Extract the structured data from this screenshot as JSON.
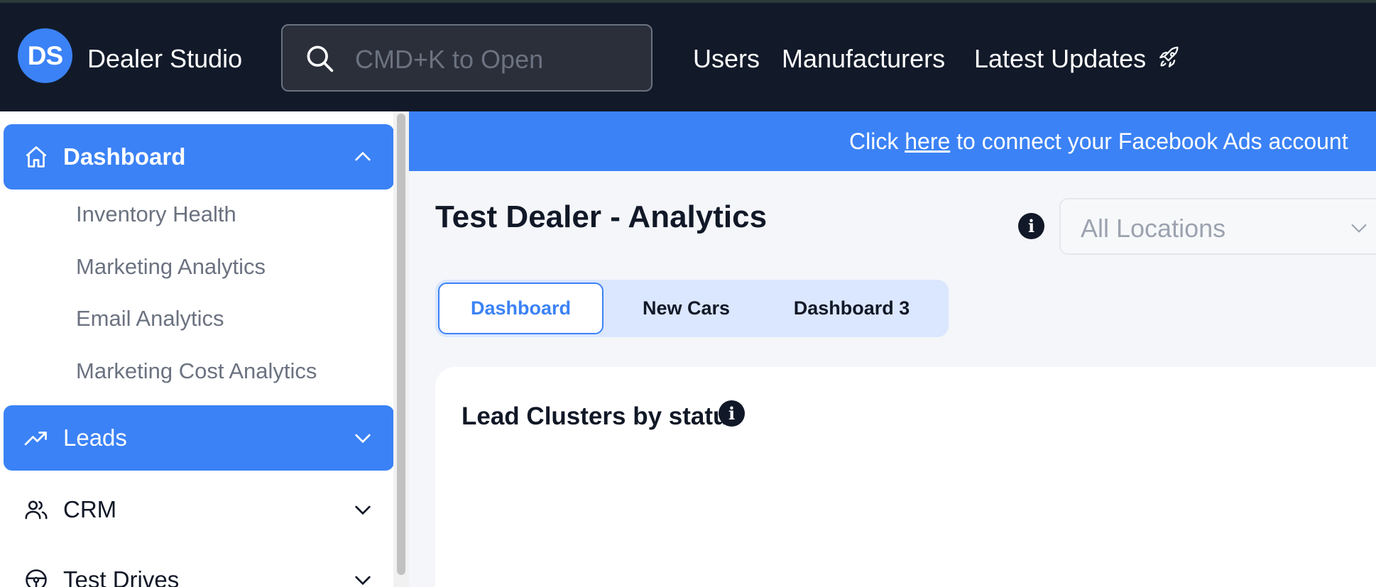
{
  "header": {
    "logo_text": "DS",
    "app_name": "Dealer Studio",
    "search_placeholder": "CMD+K to Open",
    "nav": [
      {
        "label": "Users"
      },
      {
        "label": "Manufacturers"
      },
      {
        "label": "Latest Updates",
        "icon": "rocket-icon"
      }
    ]
  },
  "sidebar": {
    "groups": [
      {
        "label": "Dashboard",
        "icon": "home-icon",
        "expanded": true,
        "active": true,
        "items": [
          "Inventory Health",
          "Marketing Analytics",
          "Email Analytics",
          "Marketing Cost Analytics"
        ]
      },
      {
        "label": "Leads",
        "icon": "trending-up-icon",
        "expanded": false,
        "active": true
      },
      {
        "label": "CRM",
        "icon": "users-icon",
        "expanded": false,
        "active": false
      },
      {
        "label": "Test Drives",
        "icon": "steering-wheel-icon",
        "expanded": false,
        "active": false
      }
    ]
  },
  "banner": {
    "prefix": "Click",
    "link": "here",
    "suffix": "to connect your Facebook Ads account"
  },
  "main": {
    "page_title": "Test Dealer - Analytics",
    "location_select": "All Locations",
    "tabs": [
      {
        "label": "Dashboard",
        "active": true
      },
      {
        "label": "New Cars",
        "active": false
      },
      {
        "label": "Dashboard 3",
        "active": false
      }
    ],
    "card_title": "Lead Clusters by status"
  },
  "colors": {
    "header_bg": "#121a2a",
    "accent": "#3b82f6",
    "tab_bar_bg": "#dbe7fe",
    "page_bg": "#f4f6fa"
  }
}
